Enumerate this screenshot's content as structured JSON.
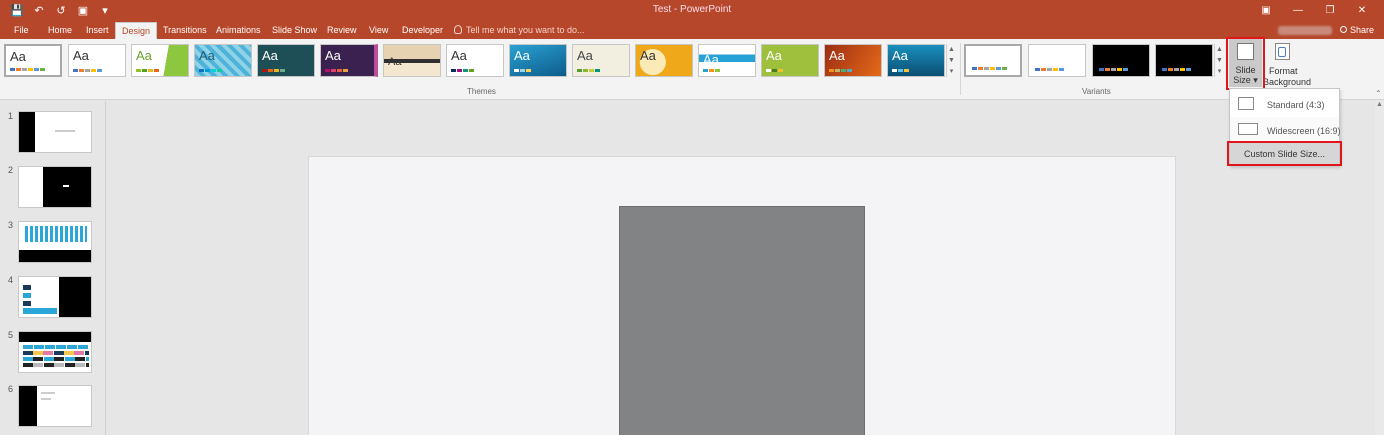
{
  "titlebar": {
    "title": "Test - PowerPoint",
    "qat": [
      "save-icon",
      "undo-icon",
      "redo-icon",
      "present-icon",
      "customize-icon"
    ],
    "window_controls": [
      "ribbon-display-icon",
      "minimize-icon",
      "restore-icon",
      "close-icon"
    ]
  },
  "tabs": {
    "file": "File",
    "home": "Home",
    "insert": "Insert",
    "design": "Design",
    "transitions": "Transitions",
    "animations": "Animations",
    "slideshow": "Slide Show",
    "review": "Review",
    "view": "View",
    "developer": "Developer",
    "tell_me": "Tell me what you want to do...",
    "share": "Share",
    "active": "Design"
  },
  "ribbon": {
    "themes_label": "Themes",
    "variants_label": "Variants",
    "theme_aa": "Aa",
    "slide_size_line1": "Slide",
    "slide_size_line2": "Size",
    "format_bg_line1": "Format",
    "format_bg_line2": "Background"
  },
  "dropdown": {
    "standard": "Standard (4:3)",
    "widescreen": "Widescreen (16:9)",
    "custom": "Custom Slide Size..."
  },
  "slides": {
    "numbers": [
      "1",
      "2",
      "3",
      "4",
      "5",
      "6"
    ],
    "selected": "none"
  },
  "colors": {
    "accent": "#b7472a",
    "highlight": "#e1161c",
    "shape_fill": "#828384"
  }
}
